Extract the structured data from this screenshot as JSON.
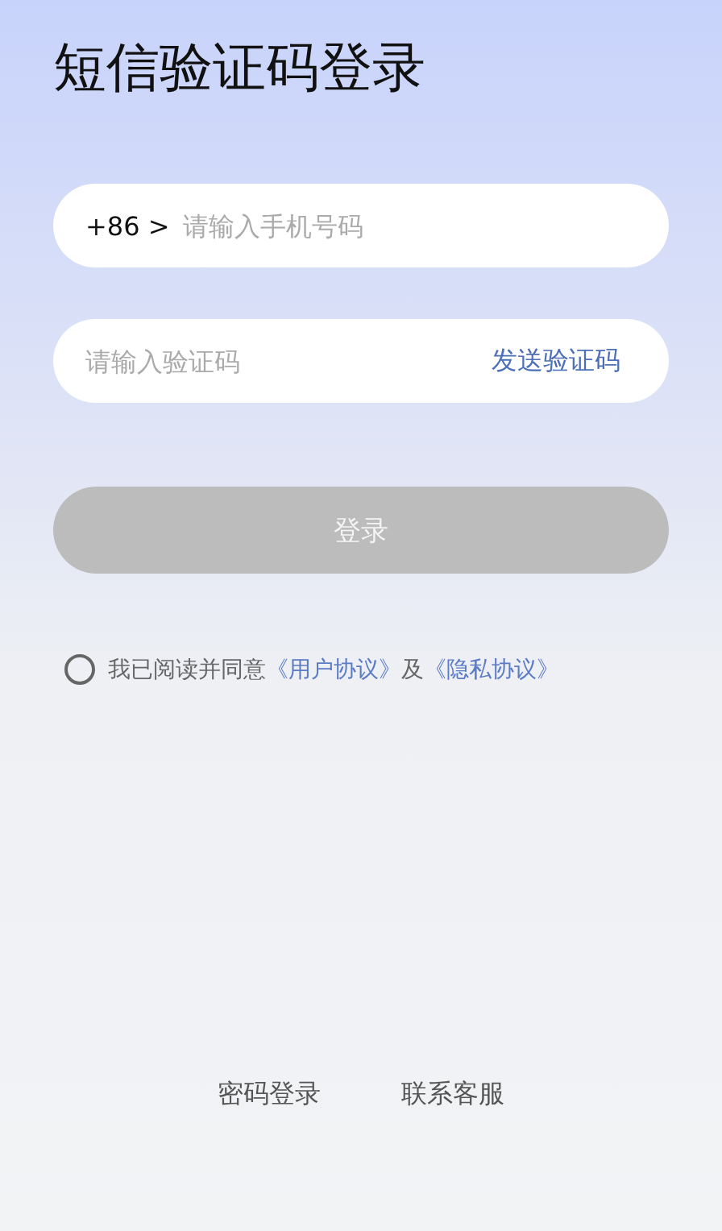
{
  "title": "短信验证码登录",
  "phone_field": {
    "country_code": "+86 >",
    "placeholder": "请输入手机号码"
  },
  "code_field": {
    "placeholder": "请输入验证码",
    "send_button": "发送验证码"
  },
  "login_button": {
    "label": "登录",
    "disabled": true
  },
  "agreement": {
    "checked": false,
    "text": "我已阅读并同意",
    "links": [
      "《用户协议》",
      "《隐私协议》"
    ],
    "joiner": "及"
  },
  "footer_links": [
    "密码登录",
    "联系客服"
  ]
}
